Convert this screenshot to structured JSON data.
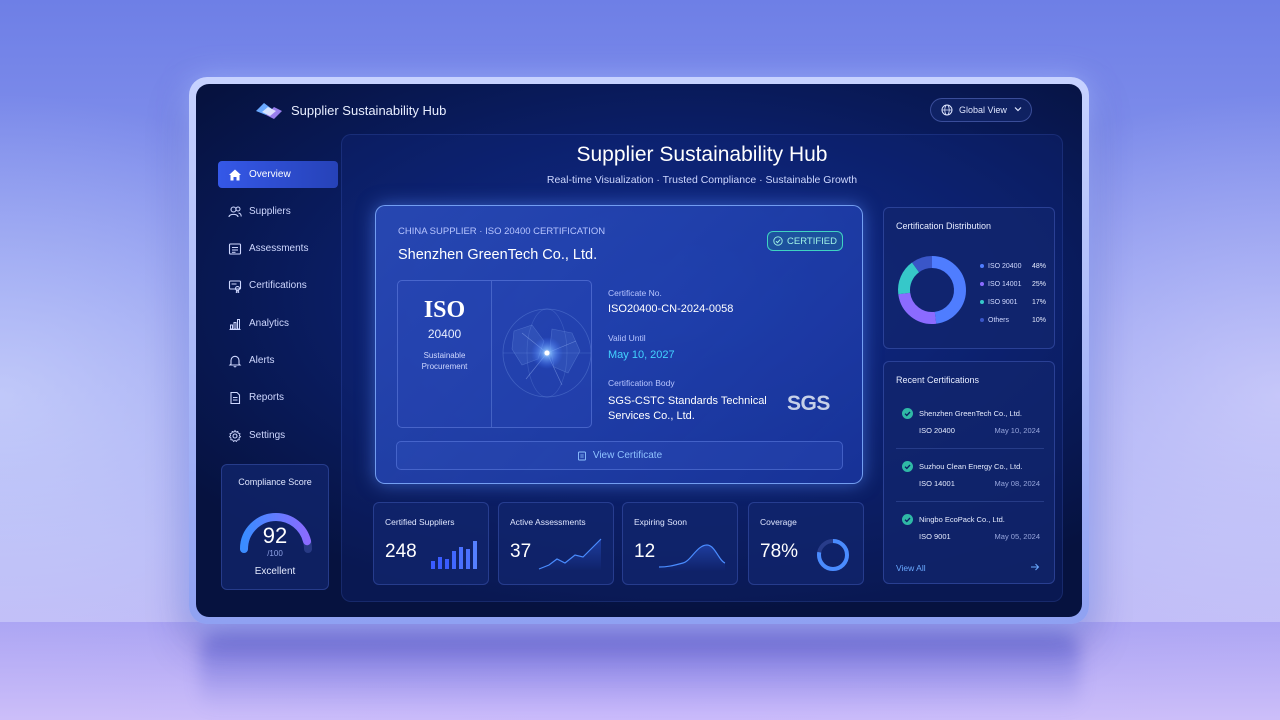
{
  "app": {
    "title": "Supplier Sustainability Hub",
    "view_selector": "Global View"
  },
  "header": {
    "title": "Supplier Sustainability Hub",
    "subtitle": "Real-time Visualization · Trusted Compliance · Sustainable Growth"
  },
  "sidebar": {
    "items": [
      {
        "label": "Overview",
        "icon": "home-icon",
        "active": true
      },
      {
        "label": "Suppliers",
        "icon": "users-icon",
        "active": false
      },
      {
        "label": "Assessments",
        "icon": "clipboard-icon",
        "active": false
      },
      {
        "label": "Certifications",
        "icon": "certificate-icon",
        "active": false
      },
      {
        "label": "Analytics",
        "icon": "bar-chart-icon",
        "active": false
      },
      {
        "label": "Alerts",
        "icon": "bell-icon",
        "active": false
      },
      {
        "label": "Reports",
        "icon": "document-icon",
        "active": false
      },
      {
        "label": "Settings",
        "icon": "gear-icon",
        "active": false
      }
    ]
  },
  "compliance": {
    "title": "Compliance Score",
    "score": "92",
    "max": "/100",
    "label": "Excellent",
    "fraction": 0.92
  },
  "certificate": {
    "eyebrow": "CHINA SUPPLIER · ISO 20400 CERTIFICATION",
    "company": "Shenzhen GreenTech Co., Ltd.",
    "badge": "CERTIFIED",
    "iso_word": "ISO",
    "iso_number": "20400",
    "iso_desc": "Sustainable Procurement",
    "cert_no_label": "Certificate No.",
    "cert_no": "ISO20400-CN-2024-0058",
    "valid_label": "Valid Until",
    "valid_until": "May 10, 2027",
    "body_label": "Certification Body",
    "body": "SGS-CSTC Standards Technical Services Co., Ltd.",
    "body_logo": "SGS",
    "action": "View Certificate"
  },
  "stats": [
    {
      "title": "Certified Suppliers",
      "value": "248",
      "graph": "bars"
    },
    {
      "title": "Active Assessments",
      "value": "37",
      "graph": "line"
    },
    {
      "title": "Expiring Soon",
      "value": "12",
      "graph": "wave"
    },
    {
      "title": "Coverage",
      "value": "78%",
      "graph": "ring",
      "fraction": 0.78
    }
  ],
  "distribution": {
    "title": "Certification Distribution",
    "items": [
      {
        "label": "ISO 20400",
        "pct": "48%",
        "value": 48,
        "color": "#4f7dff"
      },
      {
        "label": "ISO 14001",
        "pct": "25%",
        "value": 25,
        "color": "#8b6bff"
      },
      {
        "label": "ISO 9001",
        "pct": "17%",
        "value": 17,
        "color": "#36c8c9"
      },
      {
        "label": "Others",
        "pct": "10%",
        "value": 10,
        "color": "#3a56c8"
      }
    ]
  },
  "recent": {
    "title": "Recent Certifications",
    "items": [
      {
        "company": "Shenzhen GreenTech Co., Ltd.",
        "standard": "ISO 20400",
        "date": "May 10, 2024"
      },
      {
        "company": "Suzhou Clean Energy Co., Ltd.",
        "standard": "ISO 14001",
        "date": "May 08, 2024"
      },
      {
        "company": "Ningbo EcoPack Co., Ltd.",
        "standard": "ISO 9001",
        "date": "May 05, 2024"
      }
    ],
    "view_all": "View All"
  },
  "colors": {
    "accent": "#3558e8",
    "certified": "#3fd3c2",
    "highlight": "#43d3ff",
    "gauge_start": "#3a8cff",
    "gauge_end": "#8b6bff"
  }
}
